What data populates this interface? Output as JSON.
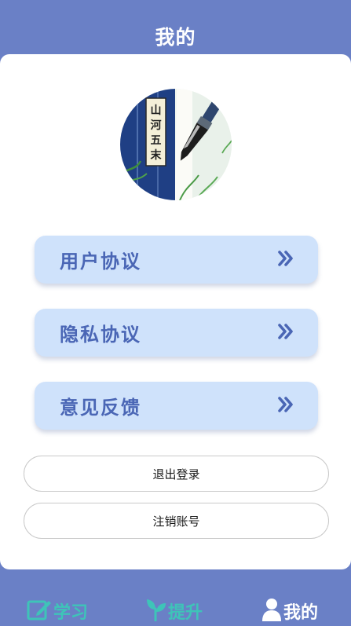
{
  "header": {
    "title": "我的"
  },
  "menu": [
    {
      "label": "用户协议"
    },
    {
      "label": "隐私协议"
    },
    {
      "label": "意见反馈"
    }
  ],
  "buttons": {
    "logout": "退出登录",
    "cancel_account": "注销账号"
  },
  "tabbar": {
    "tabs": [
      {
        "label": "学习",
        "icon": "edit-icon",
        "active": false
      },
      {
        "label": "提升",
        "icon": "sprout-icon",
        "active": false
      },
      {
        "label": "我的",
        "icon": "user-icon",
        "active": true
      }
    ]
  },
  "avatar": {
    "calligraphy": "山河五末"
  },
  "colors": {
    "header_bg": "#6a80c6",
    "menu_bg": "#cfe2fb",
    "menu_text": "#4a66b5",
    "tab_inactive": "#3ec4b8",
    "tab_active": "#ffffff"
  }
}
